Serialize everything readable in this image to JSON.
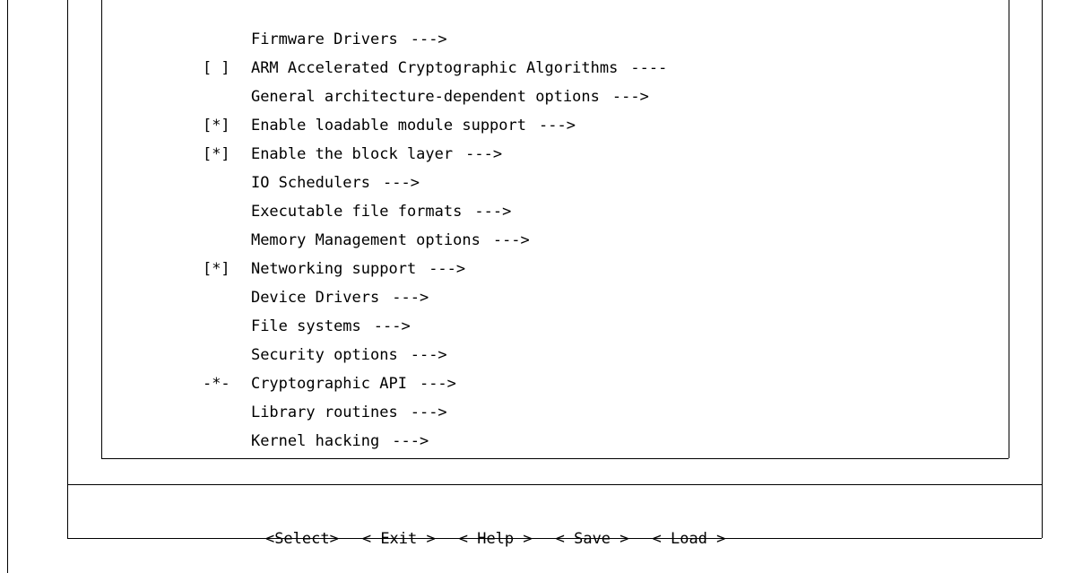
{
  "menu": {
    "items": [
      {
        "marker": "",
        "label": "Firmware Drivers",
        "suffix": "--->"
      },
      {
        "marker": "[ ]",
        "label": "ARM Accelerated Cryptographic Algorithms",
        "suffix": "----"
      },
      {
        "marker": "",
        "label": "General architecture-dependent options",
        "suffix": "--->"
      },
      {
        "marker": "[*]",
        "label": "Enable loadable module support",
        "suffix": "--->"
      },
      {
        "marker": "[*]",
        "label": "Enable the block layer",
        "suffix": "--->"
      },
      {
        "marker": "",
        "label": "IO Schedulers",
        "suffix": "--->"
      },
      {
        "marker": "",
        "label": "Executable file formats",
        "suffix": "--->"
      },
      {
        "marker": "",
        "label": "Memory Management options",
        "suffix": "--->"
      },
      {
        "marker": "[*]",
        "label": "Networking support",
        "suffix": "--->"
      },
      {
        "marker": "",
        "label": "Device Drivers",
        "suffix": "--->"
      },
      {
        "marker": "",
        "label": "File systems",
        "suffix": "--->"
      },
      {
        "marker": "",
        "label": "Security options",
        "suffix": "--->"
      },
      {
        "marker": "-*-",
        "label": "Cryptographic API",
        "suffix": "--->"
      },
      {
        "marker": "",
        "label": "Library routines",
        "suffix": "--->"
      },
      {
        "marker": "",
        "label": "Kernel hacking",
        "suffix": "--->"
      }
    ]
  },
  "buttons": {
    "select": "<Select>",
    "exit": "< Exit >",
    "help": "< Help >",
    "save": "< Save >",
    "load": "< Load >"
  }
}
